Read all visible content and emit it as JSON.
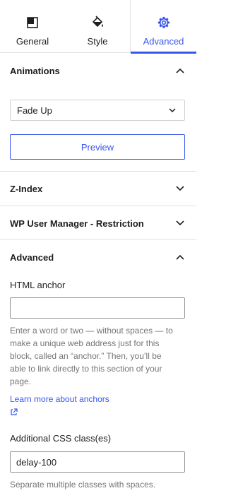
{
  "tabs": [
    {
      "label": "General",
      "icon": "block-icon"
    },
    {
      "label": "Style",
      "icon": "paint-bucket-icon"
    },
    {
      "label": "Advanced",
      "icon": "gear-icon",
      "active": true
    }
  ],
  "animations": {
    "title": "Animations",
    "select_value": "Fade Up",
    "preview_label": "Preview"
  },
  "zindex": {
    "title": "Z-Index"
  },
  "restriction": {
    "title": "WP User Manager - Restriction"
  },
  "advanced": {
    "title": "Advanced",
    "html_anchor_label": "HTML anchor",
    "html_anchor_value": "",
    "help_lines": [
      "Enter a word or two — without spaces — to",
      "make a unique web address just for this",
      "block, called an “anchor.” Then, you’ll be",
      "able to link directly to this section of your",
      "page."
    ],
    "learn_more": "Learn more about anchors",
    "css_label": "Additional CSS class(es)",
    "css_value": "delay-100",
    "css_help": "Separate multiple classes with spaces."
  },
  "colors": {
    "accent": "#3858e9",
    "text": "#1e1e1e",
    "muted": "#757575",
    "border": "#e0e0e0"
  }
}
